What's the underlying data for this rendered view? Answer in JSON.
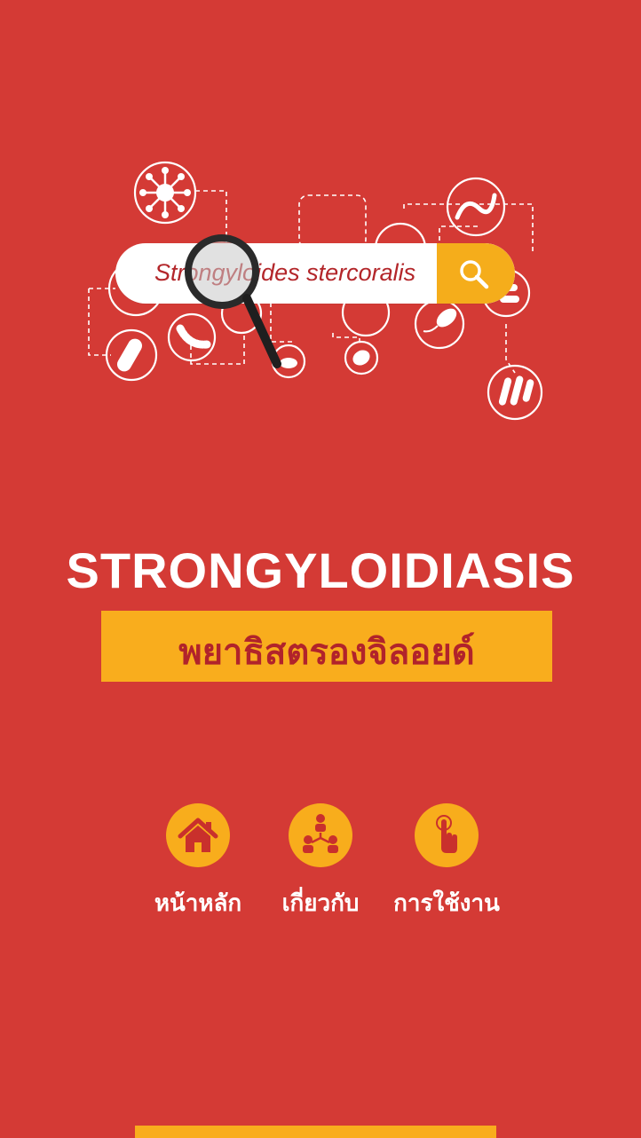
{
  "search": {
    "value": "Strongyloides stercoralis"
  },
  "title": "STRONGYLOIDIASIS",
  "subtitle": "พยาธิสตรองจิลอยด์",
  "nav": {
    "items": [
      {
        "label": "หน้าหลัก",
        "icon": "home-icon"
      },
      {
        "label": "เกี่ยวกับ",
        "icon": "team-icon"
      },
      {
        "label": "การใช้งาน",
        "icon": "tap-hand-icon"
      }
    ]
  },
  "colors": {
    "background": "#d43a35",
    "accent": "#f9ad1d",
    "title_text": "#ffffff",
    "subtitle_text": "#b1232b",
    "search_text": "#b3262a"
  }
}
